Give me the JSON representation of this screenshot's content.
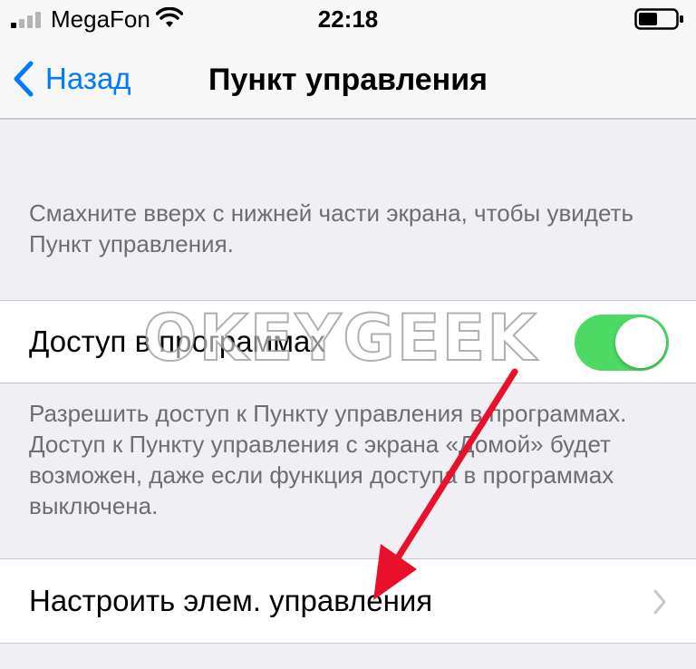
{
  "status_bar": {
    "carrier": "MegaFon",
    "time": "22:18",
    "icons": [
      "signal-icon",
      "wifi-icon",
      "battery-icon"
    ]
  },
  "nav": {
    "back_label": "Назад",
    "title": "Пункт управления"
  },
  "header_note": "Смахните вверх с нижней части экрана, чтобы увидеть Пункт управления.",
  "access": {
    "label": "Доступ в программах",
    "enabled": true,
    "note": "Разрешить доступ к Пункту управления в программах. Доступ к Пункту управления с экрана «Домой» будет возможен, даже если функция доступа в программах выключена."
  },
  "customize": {
    "label": "Настроить элем. управления"
  },
  "watermark": "OKEYGEEK",
  "colors": {
    "accent": "#007aff",
    "toggle_on": "#4cd964",
    "annotation_arrow": "#e8102a",
    "background": "#efeff4"
  }
}
